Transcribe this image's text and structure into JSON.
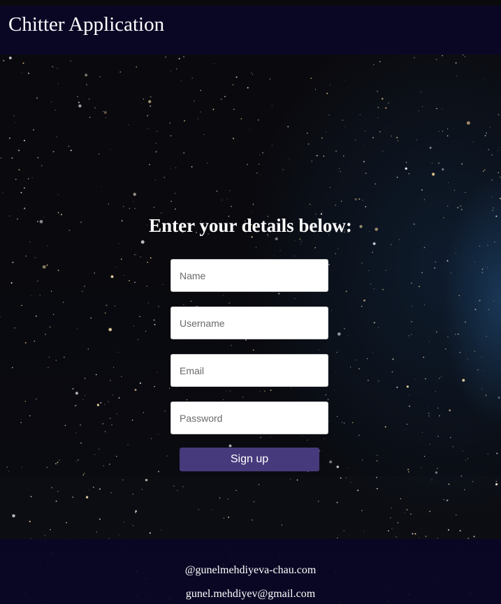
{
  "header": {
    "title": "Chitter Application"
  },
  "form": {
    "heading": "Enter your details below:",
    "fields": [
      {
        "placeholder": "Name",
        "value": ""
      },
      {
        "placeholder": "Username",
        "value": ""
      },
      {
        "placeholder": "Email",
        "value": ""
      },
      {
        "placeholder": "Password",
        "value": ""
      }
    ],
    "submit_label": "Sign up"
  },
  "footer": {
    "handle": "@gunelmehdiyeva-chau.com",
    "email": "gunel.mehdiyev@gmail.com"
  },
  "colors": {
    "header_bg": "#0a0725",
    "button_bg": "#473a7c",
    "text": "#ffffff"
  }
}
